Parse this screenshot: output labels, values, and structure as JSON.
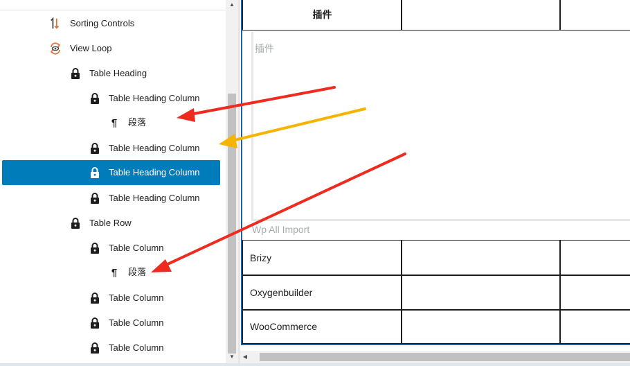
{
  "tree": {
    "items": [
      {
        "label": "Sorting Controls",
        "icon": "sort-icon"
      },
      {
        "label": "View Loop",
        "icon": "loop-icon"
      },
      {
        "label": "Table Heading",
        "icon": "lock-icon"
      },
      {
        "label": "Table Heading Column",
        "icon": "lock-icon"
      },
      {
        "label": "段落",
        "icon": "paragraph-icon"
      },
      {
        "label": "Table Heading Column",
        "icon": "lock-icon"
      },
      {
        "label": "Table Heading Column",
        "icon": "lock-icon",
        "selected": true
      },
      {
        "label": "Table Heading Column",
        "icon": "lock-icon"
      },
      {
        "label": "Table Row",
        "icon": "lock-icon"
      },
      {
        "label": "Table Column",
        "icon": "lock-icon"
      },
      {
        "label": "段落",
        "icon": "paragraph-icon"
      },
      {
        "label": "Table Column",
        "icon": "lock-icon"
      },
      {
        "label": "Table Column",
        "icon": "lock-icon"
      },
      {
        "label": "Table Column",
        "icon": "lock-icon"
      }
    ],
    "paragraph_glyph": "¶"
  },
  "editor": {
    "header_cells": [
      "插件",
      "",
      ""
    ],
    "placeholder": "插件",
    "section_placeholder": "Wp All Import",
    "rows": [
      [
        "Brizy",
        "",
        ""
      ],
      [
        "Oxygenbuilder",
        "",
        ""
      ],
      [
        "WooCommerce",
        "",
        ""
      ]
    ]
  },
  "colors": {
    "selection": "#007cba",
    "arrow_red": "#ee2b1f",
    "arrow_yellow": "#f5b400",
    "frame_blue": "#1e5fa3"
  }
}
